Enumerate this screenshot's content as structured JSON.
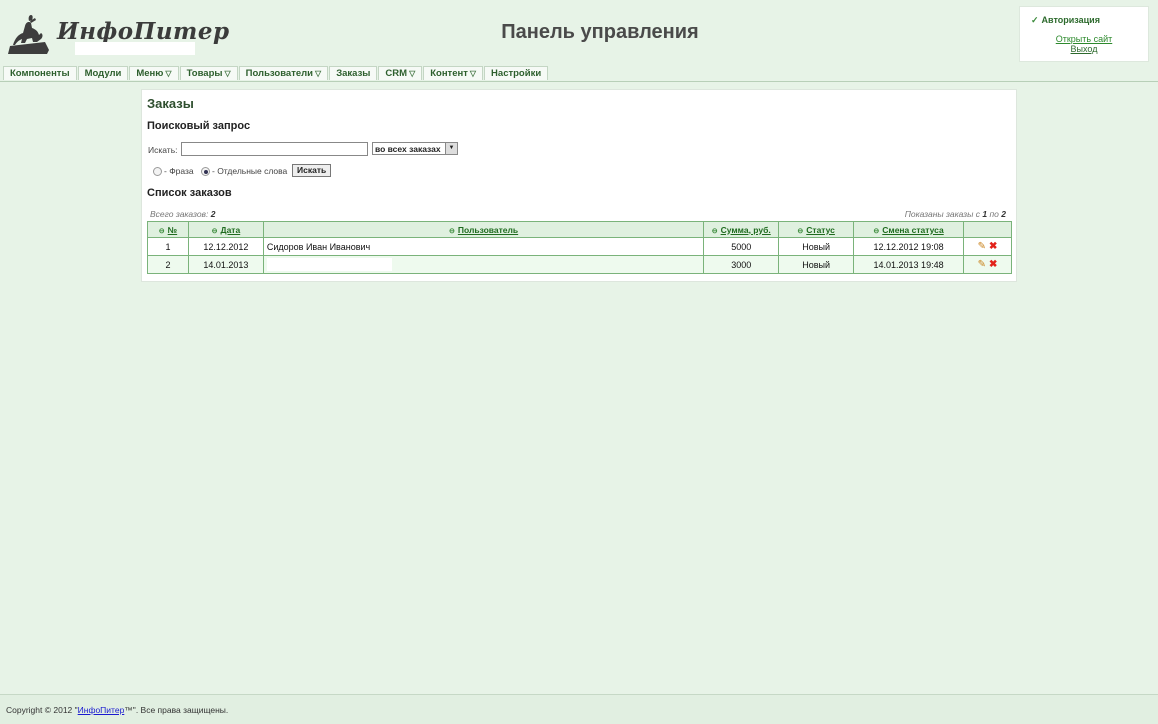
{
  "header": {
    "logo_text": "ИнфоПитер",
    "page_title": "Панель управления"
  },
  "auth": {
    "title": "Авторизация",
    "open_site": "Открыть сайт",
    "logout": "Выход"
  },
  "menu": {
    "items": [
      {
        "label": "Компоненты",
        "dropdown": false
      },
      {
        "label": "Модули",
        "dropdown": false
      },
      {
        "label": "Меню",
        "dropdown": true
      },
      {
        "label": "Товары",
        "dropdown": true
      },
      {
        "label": "Пользователи",
        "dropdown": true
      },
      {
        "label": "Заказы",
        "dropdown": false
      },
      {
        "label": "CRM",
        "dropdown": true
      },
      {
        "label": "Контент",
        "dropdown": true
      },
      {
        "label": "Настройки",
        "dropdown": false
      }
    ]
  },
  "orders_page": {
    "title": "Заказы",
    "search": {
      "heading": "Поисковый запрос",
      "label": "Искать:",
      "value": "",
      "scope": "во всех заказах",
      "mode_phrase": "- Фраза",
      "mode_words": "- Отдельные слова",
      "mode_selected": "words",
      "button": "Искать"
    },
    "list": {
      "heading": "Список заказов",
      "total_label": "Всего заказов:",
      "total_count": "2",
      "shown_prefix": "Показаны заказы с",
      "shown_from": "1",
      "shown_mid": "по",
      "shown_to": "2"
    },
    "columns": [
      "№",
      "Дата",
      "Пользователь",
      "Сумма, руб.",
      "Статус",
      "Смена статуса"
    ],
    "rows": [
      {
        "num": "1",
        "date": "12.12.2012",
        "user": "Сидоров Иван Иванович",
        "sum": "5000",
        "status": "Новый",
        "status_change": "12.12.2012 19:08"
      },
      {
        "num": "2",
        "date": "14.01.2013",
        "user": "",
        "sum": "3000",
        "status": "Новый",
        "status_change": "14.01.2013 19:48"
      }
    ]
  },
  "footer": {
    "prefix": "Copyright © 2012 \"",
    "brand": "ИнфоПитер",
    "suffix": "™\". Все права защищены."
  }
}
